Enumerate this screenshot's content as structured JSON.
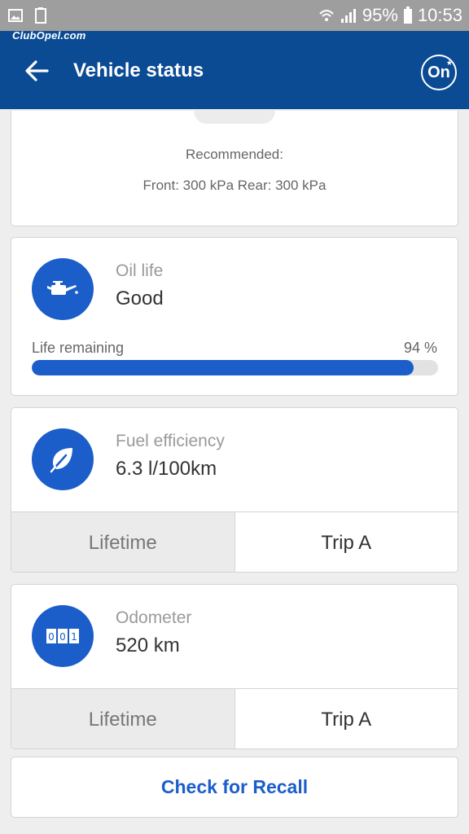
{
  "status_bar": {
    "battery": "95%",
    "time": "10:53",
    "icons": [
      "gallery-icon",
      "screenshot-icon",
      "wifi-icon",
      "signal-icon",
      "battery-icon"
    ]
  },
  "watermark": "ClubOpel.com",
  "app_bar": {
    "title": "Vehicle status",
    "back_icon": "arrow-left-icon",
    "brand_button_label": "On",
    "brand_icon": "onstar-icon"
  },
  "tire_pressure": {
    "recommended_label": "Recommended:",
    "values": "Front: 300 kPa Rear: 300 kPa"
  },
  "oil": {
    "label": "Oil life",
    "value": "Good",
    "life_label": "Life remaining",
    "life_percent": "94 %",
    "life_fraction": 0.94,
    "icon": "oil-can-icon"
  },
  "fuel": {
    "label": "Fuel efficiency",
    "value": "6.3 l/100km",
    "icon": "leaf-icon",
    "tabs": [
      "Lifetime",
      "Trip A"
    ],
    "selected_tab": "Trip A"
  },
  "odometer": {
    "label": "Odometer",
    "value": "520 km",
    "icon": "odometer-icon",
    "counter_digits": [
      "0",
      "0",
      "1"
    ],
    "tabs": [
      "Lifetime",
      "Trip A"
    ],
    "selected_tab": "Trip A"
  },
  "recall_button": "Check for Recall",
  "colors": {
    "app_bar": "#0a4b94",
    "accent": "#1b5ec9",
    "status_bar": "#9e9e9e",
    "background": "#eeeeee",
    "tab_inactive": "#ebebeb"
  }
}
